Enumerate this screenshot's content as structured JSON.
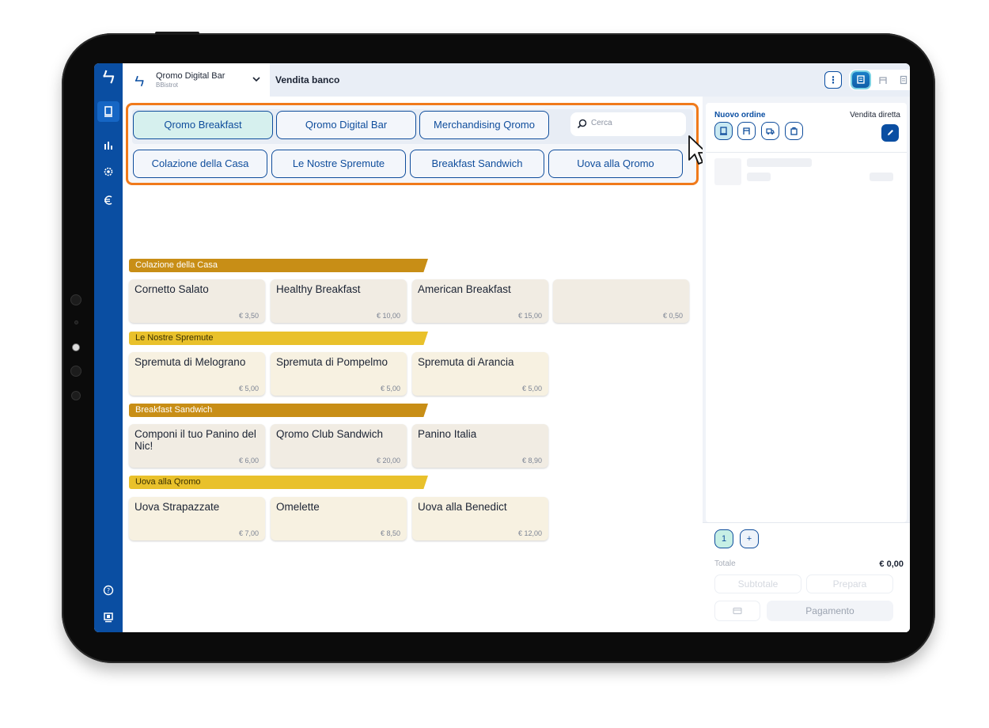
{
  "header": {
    "venue_name": "Qromo Digital Bar",
    "venue_sub": "BBistrot",
    "title": "Vendita banco",
    "menu_icon": "more-vertical-icon",
    "view_tabs": [
      "counter-sale-icon",
      "table-service-icon",
      "orders-list-icon"
    ]
  },
  "sidebar": {
    "items": [
      "pos-icon",
      "stats-icon",
      "settings-icon",
      "euro-icon",
      "help-icon",
      "display-icon"
    ]
  },
  "menus": {
    "items": [
      {
        "label": "Qromo Breakfast",
        "selected": true
      },
      {
        "label": "Qromo Digital Bar",
        "selected": false
      },
      {
        "label": "Merchandising Qromo",
        "selected": false
      }
    ],
    "search_placeholder": "Cerca"
  },
  "categories": {
    "items": [
      "Colazione della Casa",
      "Le Nostre Spremute",
      "Breakfast Sandwich",
      "Uova alla Qromo"
    ]
  },
  "sections": [
    {
      "title": "Colazione della Casa",
      "color": "#c88e16",
      "products": [
        {
          "name": "Cornetto Salato",
          "price": "€ 3,50"
        },
        {
          "name": "Healthy Breakfast",
          "price": "€ 10,00"
        },
        {
          "name": "American Breakfast",
          "price": "€ 15,00"
        },
        {
          "name": "",
          "price": "€ 0,50"
        }
      ]
    },
    {
      "title": "Le Nostre Spremute",
      "color": "#e9c12b",
      "products": [
        {
          "name": "Spremuta di Melograno",
          "price": "€ 5,00"
        },
        {
          "name": "Spremuta di Pompelmo",
          "price": "€ 5,00"
        },
        {
          "name": "Spremuta di Arancia",
          "price": "€ 5,00"
        }
      ]
    },
    {
      "title": "Breakfast Sandwich",
      "color": "#c88e16",
      "products": [
        {
          "name": "Componi il tuo Panino del Nic!",
          "price": "€ 6,00"
        },
        {
          "name": "Qromo Club Sandwich",
          "price": "€ 20,00"
        },
        {
          "name": "Panino Italia",
          "price": "€ 8,90"
        }
      ]
    },
    {
      "title": "Uova alla Qromo",
      "color": "#e9c12b",
      "products": [
        {
          "name": "Uova Strapazzate",
          "price": "€ 7,00"
        },
        {
          "name": "Omelette",
          "price": "€ 8,50"
        },
        {
          "name": "Uova alla Benedict",
          "price": "€ 12,00"
        }
      ]
    }
  ],
  "order": {
    "title": "Nuovo ordine",
    "mode": "Vendita diretta",
    "order_types": [
      "counter-icon",
      "table-icon",
      "delivery-icon",
      "takeaway-icon"
    ],
    "tabs": [
      "1",
      "+"
    ],
    "total_label": "Totale",
    "total_value": "€ 0,00",
    "subtotal_label": "Subtotale",
    "prepare_label": "Prepara",
    "pay_label": "Pagamento"
  }
}
